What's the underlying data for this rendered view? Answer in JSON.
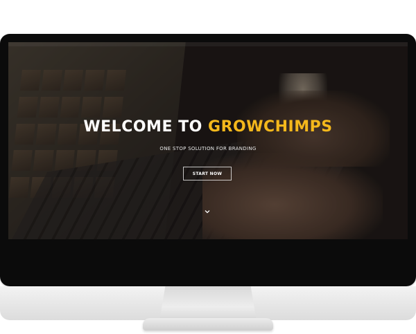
{
  "hero": {
    "title_prefix": "WELCOME TO",
    "title_brand": "GROWCHIMPS",
    "subtitle": "ONE STOP SOLUTION FOR BRANDING",
    "cta_label": "START NOW",
    "scroll_icon": "chevron-down-icon"
  },
  "colors": {
    "accent": "#f4b81c",
    "text": "#ffffff",
    "monitor_bezel": "#0b0b0b",
    "monitor_chin": "#e6e6e6"
  }
}
